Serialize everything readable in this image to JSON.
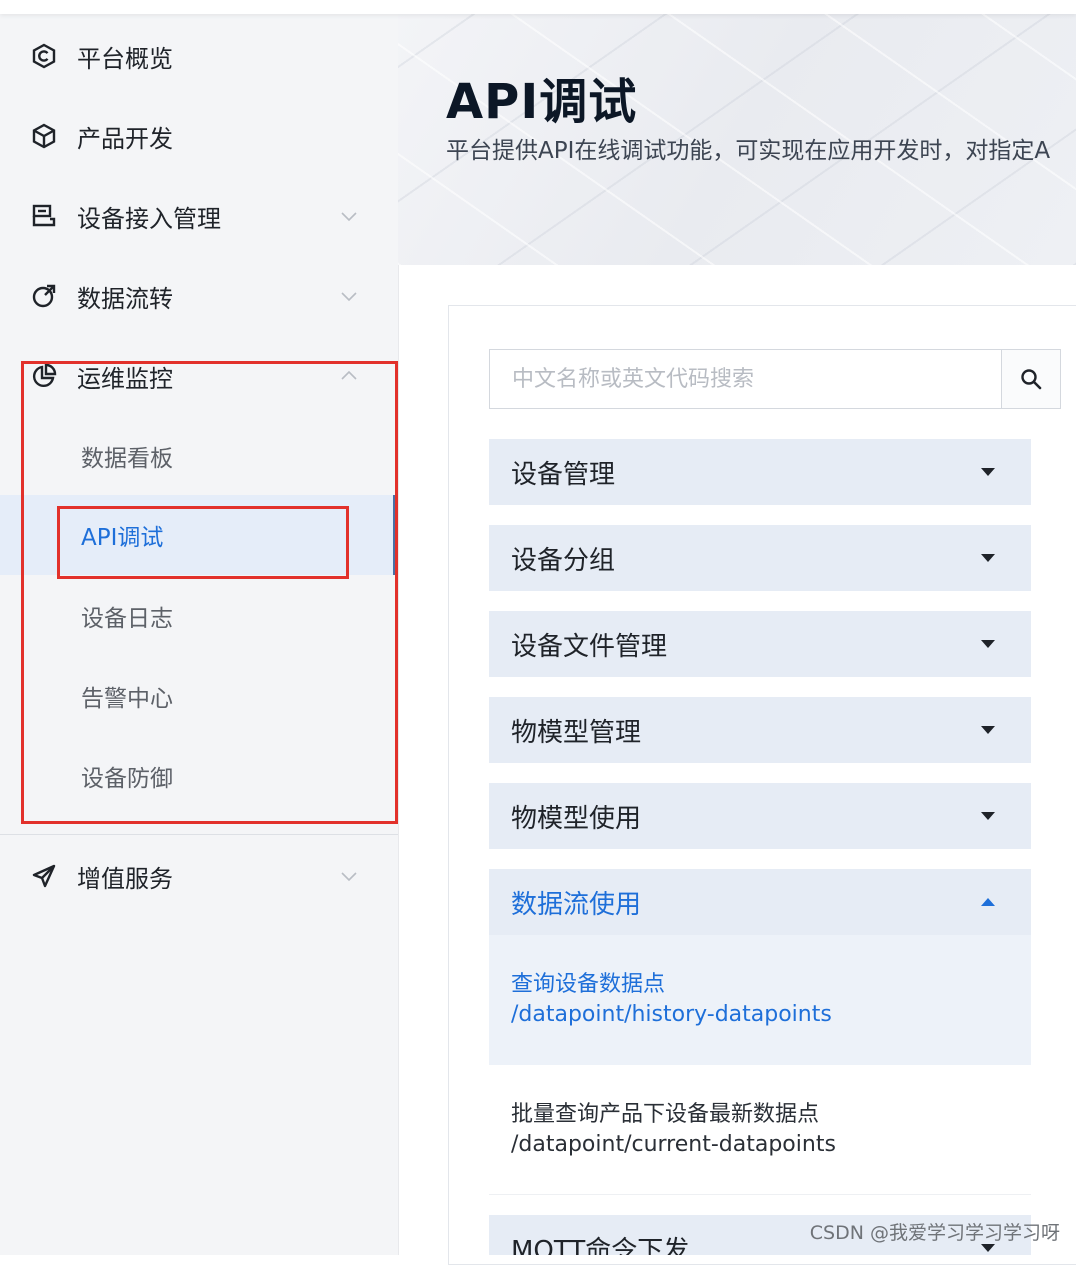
{
  "sidebar": {
    "items": [
      {
        "label": "平台概览",
        "icon": "overview-icon"
      },
      {
        "label": "产品开发",
        "icon": "cube-icon"
      },
      {
        "label": "设备接入管理",
        "icon": "device-access-icon"
      },
      {
        "label": "数据流转",
        "icon": "data-flow-icon"
      },
      {
        "label": "运维监控",
        "icon": "pie-chart-icon"
      },
      {
        "label": "增值服务",
        "icon": "paper-plane-icon"
      }
    ],
    "ops_sub_items": [
      {
        "label": "数据看板"
      },
      {
        "label": "API调试"
      },
      {
        "label": "设备日志"
      },
      {
        "label": "告警中心"
      },
      {
        "label": "设备防御"
      }
    ]
  },
  "header": {
    "title": "API调试",
    "description": "平台提供API在线调试功能，可实现在应用开发时，对指定A"
  },
  "search": {
    "placeholder": "中文名称或英文代码搜索"
  },
  "categories": [
    {
      "label": "设备管理"
    },
    {
      "label": "设备分组"
    },
    {
      "label": "设备文件管理"
    },
    {
      "label": "物模型管理"
    },
    {
      "label": "物模型使用"
    },
    {
      "label": "数据流使用"
    },
    {
      "label": "MQTT命令下发"
    }
  ],
  "apis": [
    {
      "name": "查询设备数据点",
      "path": "/datapoint/history-datapoints"
    },
    {
      "name": "批量查询产品下设备最新数据点",
      "path": "/datapoint/current-datapoints"
    }
  ],
  "watermark": "CSDN @我爱学习学习学习呀",
  "colors": {
    "accent": "#1e6fd9",
    "highlight_box": "#e2312b",
    "category_bg": "#e6ecf5"
  }
}
